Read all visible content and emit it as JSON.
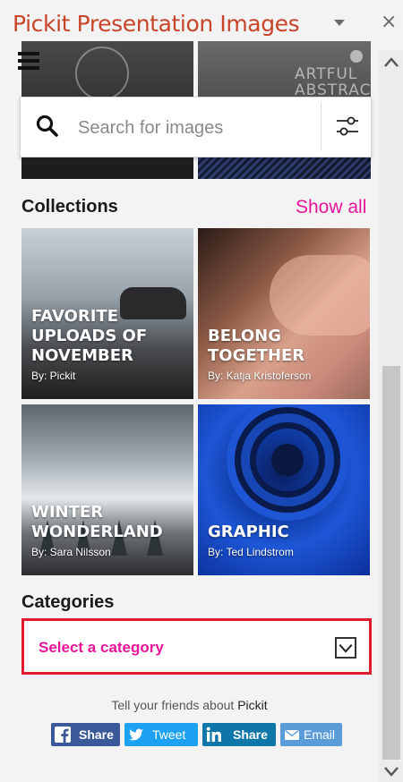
{
  "window": {
    "title": "Pickit Presentation Images",
    "close_symbol": "×"
  },
  "hero": {
    "right_tile_text_line1": "ARTFUL",
    "right_tile_text_line2": "ABSTRACTS"
  },
  "search": {
    "placeholder": "Search for images"
  },
  "collections": {
    "heading": "Collections",
    "show_all": "Show all",
    "items": [
      {
        "title": "FAVORITE UPLOADS OF NOVEMBER",
        "by": "By: Pickit"
      },
      {
        "title": "BELONG TOGETHER",
        "by": "By: Katja Kristoferson"
      },
      {
        "title": "WINTER WONDERLAND",
        "by": "By: Sara Nilsson"
      },
      {
        "title": "GRAPHIC",
        "by": "By: Ted Lindstrom"
      }
    ]
  },
  "categories": {
    "heading": "Categories",
    "select_value": "Select a category"
  },
  "share": {
    "prompt": "Tell your friends about",
    "brand": "Pickit",
    "buttons": [
      {
        "label": "Share",
        "icon": "facebook-icon",
        "color": "#3b5998"
      },
      {
        "label": "Tweet",
        "icon": "twitter-icon",
        "color": "#1da1f2"
      },
      {
        "label": "Share",
        "icon": "linkedin-icon",
        "color": "#0e76a8"
      },
      {
        "label": "Email",
        "icon": "email-icon",
        "color": "#5a9bd8"
      }
    ]
  },
  "colors": {
    "title": "#c8452a",
    "accent": "#e6159a",
    "highlight_border": "#e01b2f"
  }
}
